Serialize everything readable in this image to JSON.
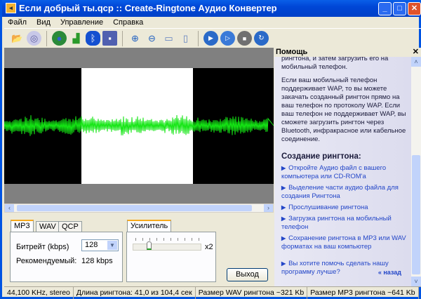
{
  "window": {
    "title": "Если  добрый  ты.qcp :: Create-Ringtone Аудио Конвертер"
  },
  "menu": [
    "Файл",
    "Вид",
    "Управление",
    "Справка"
  ],
  "toolbar": [
    "open-folder",
    "cd",
    "web",
    "signal",
    "bluetooth",
    "save",
    "zoom-in",
    "zoom-out",
    "zoom-selection",
    "zoom-fit",
    "play",
    "play-selection",
    "stop",
    "loop"
  ],
  "colors": {
    "wave": "#14e614",
    "selection": "#ffffff",
    "accent": "#f7a81b"
  },
  "format_tabs": [
    "MP3",
    "WAV",
    "QCP"
  ],
  "mp3": {
    "bitrate_label": "Битрейт (kbps)",
    "bitrate_value": "128",
    "recommended_label": "Рекомендуемый:",
    "recommended_value": "128 kbps"
  },
  "amplifier": {
    "tab": "Усилитель",
    "value_label": "x2",
    "level": 0.2
  },
  "exit_label": "Выход",
  "help": {
    "title": "Помощь",
    "paragraphs": [
      "рингтона, и затем загрузить его на мобильный телефон.",
      "Если ваш мобильный телефон поддерживает WAP, то вы можете закачать созданный рингтон прямо на ваш телефон по протоколу WAP. Если ваш телефон не поддерживает WAP,  вы сможете загрузить рингтон через Bluetooth, инфракрасное или кабельное соединение."
    ],
    "heading": "Создание рингтона:",
    "links": [
      "Откройте Аудио файл с вашего компьютера или CD-ROM'a",
      "Выделение части аудио файла для создания Рингтона",
      "Прослушивание рингтона",
      "Загрузка рингтона на мобильный телефон",
      "Сохранение рингтона в MP3 или WAV форматах на ваш компьютер"
    ],
    "help_link": "Вы хотите помочь сделать нашу программу лучше?",
    "back": "« назад"
  },
  "status": [
    "44,100 KHz, stereo",
    "Длина рингтона: 41,0 из 104,4 сек",
    "Размер WAV рингтона ~321 Kb",
    "Размер MP3 рингтона ~641 Kb"
  ]
}
